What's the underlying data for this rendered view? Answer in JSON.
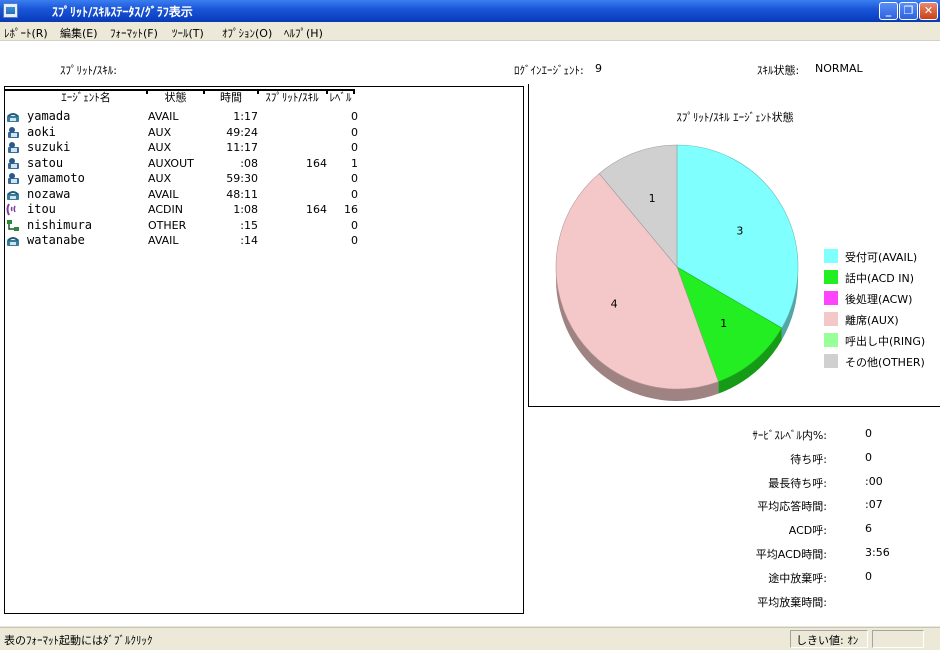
{
  "window": {
    "title": "ｽﾌﾟﾘｯﾄ/ｽｷﾙｽﾃｰﾀｽ/ｸﾞﾗﾌ表示",
    "buttons": {
      "minimize": "_",
      "maximize": "❐",
      "close": "✕"
    }
  },
  "menu": [
    "ﾚﾎﾟｰﾄ(R)",
    "編集(E)",
    "ﾌｫｰﾏｯﾄ(F)",
    "ﾂｰﾙ(T)",
    "ｵﾌﾟｼｮﾝ(O)",
    "ﾍﾙﾌﾟ(H)"
  ],
  "info": {
    "split_label": "ｽﾌﾟﾘｯﾄ/ｽｷﾙ:",
    "login_agents_label": "ﾛｸﾞｲﾝｴｰｼﾞｪﾝﾄ:",
    "login_agents_value": "9",
    "skill_state_label": "ｽｷﾙ状態:",
    "skill_state_value": "NORMAL"
  },
  "table": {
    "headers": [
      "ｴｰｼﾞｪﾝﾄ名",
      "状態",
      "時間",
      "ｽﾌﾟﾘｯﾄ/ｽｷﾙ",
      "ﾚﾍﾞﾙ"
    ],
    "rows": [
      {
        "icon": "phone-icon",
        "name": "yamada",
        "state": "AVAIL",
        "time": "1:17",
        "split": "",
        "level": "0"
      },
      {
        "icon": "person-icon",
        "name": "aoki",
        "state": "AUX",
        "time": "49:24",
        "split": "",
        "level": "0"
      },
      {
        "icon": "person-icon",
        "name": "suzuki",
        "state": "AUX",
        "time": "11:17",
        "split": "",
        "level": "0"
      },
      {
        "icon": "person-icon",
        "name": "satou",
        "state": "AUXOUT",
        "time": ":08",
        "split": "164",
        "level": "1"
      },
      {
        "icon": "person-icon",
        "name": "yamamoto",
        "state": "AUX",
        "time": "59:30",
        "split": "",
        "level": "0"
      },
      {
        "icon": "phone-icon",
        "name": "nozawa",
        "state": "AVAIL",
        "time": "48:11",
        "split": "",
        "level": "0"
      },
      {
        "icon": "ringing-phone-icon",
        "name": "itou",
        "state": "ACDIN",
        "time": "1:08",
        "split": "164",
        "level": "16"
      },
      {
        "icon": "network-icon",
        "name": "nishimura",
        "state": "OTHER",
        "time": ":15",
        "split": "",
        "level": "0"
      },
      {
        "icon": "phone-icon",
        "name": "watanabe",
        "state": "AVAIL",
        "time": ":14",
        "split": "",
        "level": "0"
      }
    ]
  },
  "chart_data": {
    "type": "pie",
    "title": "ｽﾌﾟﾘｯﾄ/ｽｷﾙ ｴｰｼﾞｪﾝﾄ状態",
    "legend_position": "right",
    "slices": [
      {
        "label": "受付可(AVAIL)",
        "value": 3,
        "color": "#80ffff"
      },
      {
        "label": "話中(ACD IN)",
        "value": 1,
        "color": "#22ee22"
      },
      {
        "label": "後処理(ACW)",
        "value": 0,
        "color": "#ff44ff"
      },
      {
        "label": "離席(AUX)",
        "value": 4,
        "color": "#f4c8c8"
      },
      {
        "label": "呼出し中(RING)",
        "value": 0,
        "color": "#99ff99"
      },
      {
        "label": "その他(OTHER)",
        "value": 1,
        "color": "#d0d0d0"
      }
    ]
  },
  "stats": [
    {
      "label": "ｻｰﾋﾞｽﾚﾍﾞﾙ内%:",
      "value": "0"
    },
    {
      "label": "待ち呼:",
      "value": "0"
    },
    {
      "label": "最長待ち呼:",
      "value": ":00"
    },
    {
      "label": "平均応答時間:",
      "value": ":07"
    },
    {
      "label": "ACD呼:",
      "value": "6"
    },
    {
      "label": "平均ACD時間:",
      "value": "3:56"
    },
    {
      "label": "途中放棄呼:",
      "value": "0"
    },
    {
      "label": "平均放棄時間:",
      "value": ""
    }
  ],
  "status": {
    "hint": "表のﾌｫｰﾏｯﾄ起動にはﾀﾞﾌﾞﾙｸﾘｯｸ",
    "threshold": "しきい値: ｵﾝ"
  }
}
